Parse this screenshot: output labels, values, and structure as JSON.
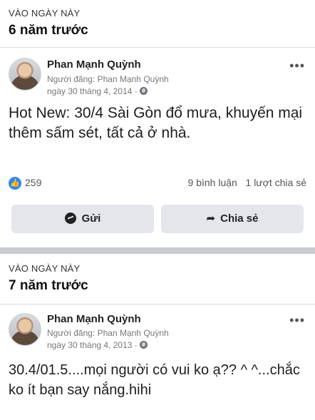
{
  "memories": [
    {
      "kicker": "VÀO NGÀY NÀY",
      "title": "6 năm trước",
      "author": "Phan Mạnh Quỳnh",
      "posted_by": "Người đăng: Phan Mạnh Quỳnh",
      "date": "ngày 30 tháng 4, 2014 ·",
      "more": "•••",
      "text": "Hot New: 30/4 Sài Gòn đổ mưa, khuyến mại thêm sấm sét, tất cả ở nhà.",
      "likes": "259",
      "comments": "9 bình luận",
      "shares": "1 lượt chia sẻ",
      "send_label": "Gửi",
      "share_label": "Chia sẻ"
    },
    {
      "kicker": "VÀO NGÀY NÀY",
      "title": "7 năm trước",
      "author": "Phan Mạnh Quỳnh",
      "posted_by": "Người đăng: Phan Mạnh Quỳnh",
      "date": "ngày 30 tháng 4, 2013 ·",
      "more": "•••",
      "text": "30.4/01.5....mọi người có vui ko ạ?? ^ ^...chắc ko ít bạn say nắng.hihi"
    }
  ],
  "colors": {
    "like_blue": "#2d88ff",
    "button_bg": "#e4e6eb",
    "divider": "#c9ccd1"
  },
  "icons": {
    "like": "thumbs-up-icon",
    "messenger": "messenger-icon",
    "share": "share-arrow-icon",
    "privacy": "globe-icon",
    "more": "more-options-icon"
  }
}
